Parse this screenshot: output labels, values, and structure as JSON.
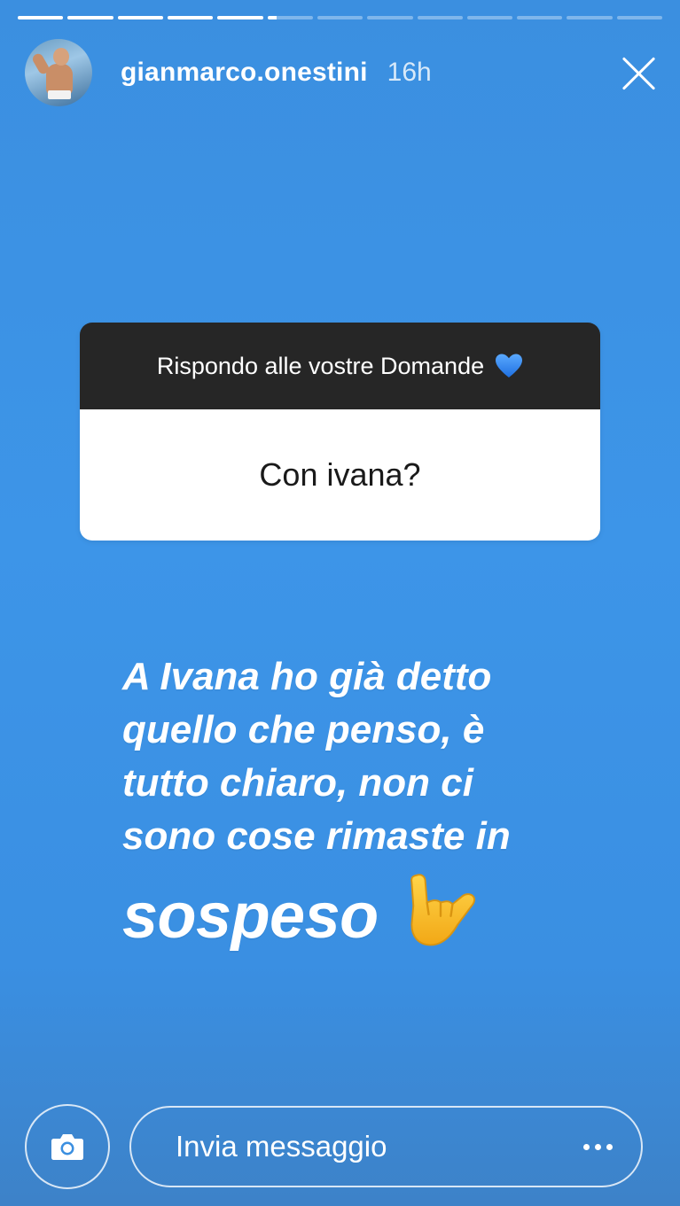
{
  "story": {
    "progress": [
      1,
      1,
      1,
      1,
      1,
      0.2,
      0,
      0,
      0,
      0,
      0,
      0,
      0
    ],
    "background_color": "#3b8fe0"
  },
  "header": {
    "username": "gianmarco.onestini",
    "time": "16h",
    "close_icon": "close-icon"
  },
  "question_sticker": {
    "title": "Rispondo alle vostre Domande",
    "title_emoji": "blue-heart-icon",
    "question": "Con ivana?",
    "header_color": "#262626"
  },
  "answer": {
    "lines": [
      "A Ivana ho già detto",
      "quello che penso, è",
      "tutto chiaro, non ci",
      "sono cose rimaste in"
    ],
    "last_word": "sospeso",
    "emoji": "call-me-hand-icon"
  },
  "footer": {
    "camera_icon": "camera-icon",
    "message_placeholder": "Invia messaggio",
    "more_icon": "more-icon"
  }
}
